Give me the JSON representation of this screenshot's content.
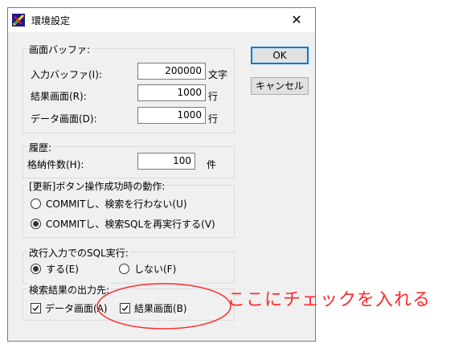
{
  "window": {
    "title": "環境設定",
    "close": "✕"
  },
  "icons": {
    "app": "app-icon",
    "close": "close-icon",
    "check": "check-icon"
  },
  "buttons": {
    "ok": "OK",
    "cancel": "キャンセル"
  },
  "buffer": {
    "title": "画面バッファ:",
    "input_label": "入力バッファ(I):",
    "input_value": "200000",
    "input_unit": "文字",
    "result_label": "結果画面(R):",
    "result_value": "1000",
    "result_unit": "行",
    "data_label": "データ画面(D):",
    "data_value": "1000",
    "data_unit": "行"
  },
  "history": {
    "title": "履歴:",
    "count_label": "格納件数(H):",
    "count_value": "100",
    "count_unit": "件"
  },
  "update": {
    "title": "[更新]ボタン操作成功時の動作:",
    "options": [
      {
        "label": "COMMITし、検索を行わない(U)",
        "selected": false
      },
      {
        "label": "COMMITし、検索SQLを再実行する(V)",
        "selected": true
      }
    ]
  },
  "newline": {
    "title": "改行入力でのSQL実行:",
    "options": [
      {
        "label": "する(E)",
        "selected": true
      },
      {
        "label": "しない(F)",
        "selected": false
      }
    ]
  },
  "output": {
    "title": "検索結果の出力先:",
    "options": [
      {
        "label": "データ画面(A)",
        "checked": true
      },
      {
        "label": "結果画面(B)",
        "checked": true
      }
    ]
  },
  "annotation": {
    "text": "ここにチェックを入れる",
    "color": "#ff2a2a"
  }
}
